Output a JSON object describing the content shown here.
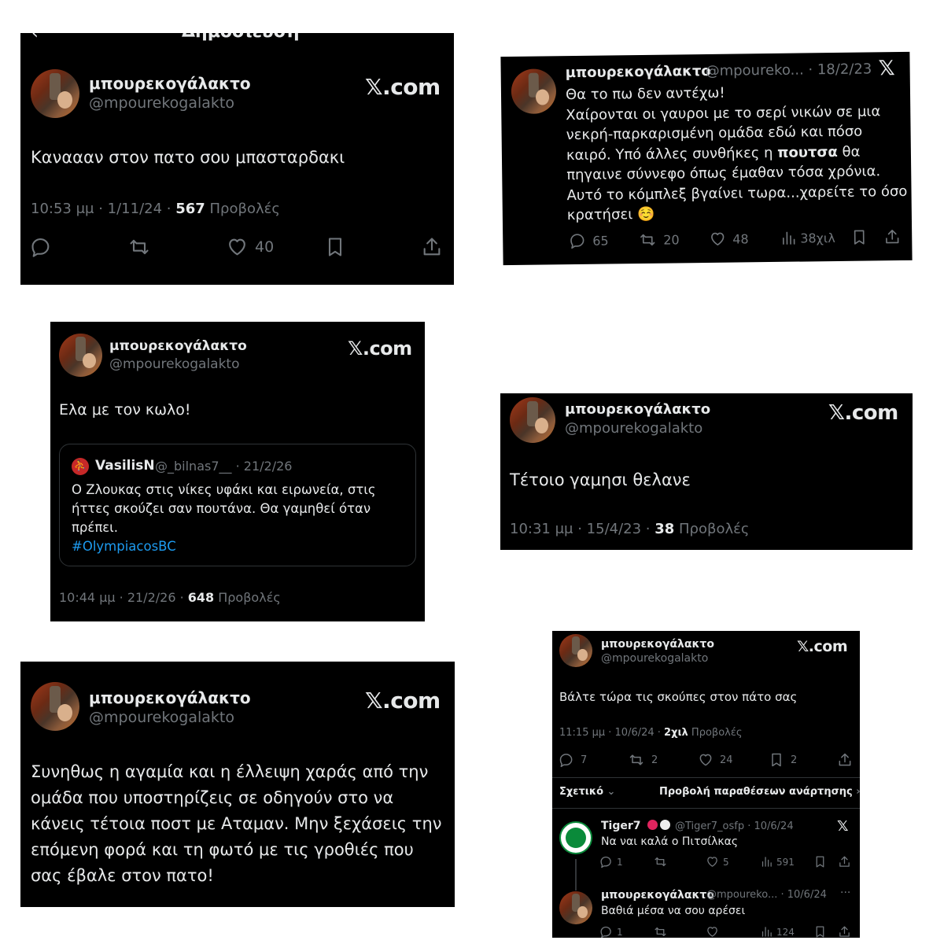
{
  "account": {
    "name": "μπουρεκογάλακτο",
    "handle": "@mpourekogalakto",
    "handle_short": "@mpoureko...",
    "brand": "𝕏.com",
    "x_logo": "𝕏"
  },
  "card1": {
    "header_partial": "Δημοσίευση",
    "text": "Καναααν στον πατο σου μπασταρδακι",
    "time": "10:53 μμ · 1/11/24 · ",
    "views": "567",
    "views_label": " Προβολές",
    "likes": "40"
  },
  "card2": {
    "date": " · 18/2/23",
    "line1": "Θα το πω δεν αντέχω!",
    "line2": "Χαίρονται οι γαυροι με το σερί νικών σε μια",
    "line3": "νεκρή-παρκαρισμένη ομάδα εδώ και πόσο",
    "line4a": "καιρό. Υπό άλλες συνθήκες η ",
    "line4b": "πουτσα",
    "line4c": " θα",
    "line5": "πηγαινε σύννεφο όπως έμαθαν τόσα χρόνια.",
    "line6": "Αυτό το κόμπλεξ βγαίνει τωρα...χαρείτε το όσο",
    "line7": "κρατήσει ☺️",
    "replies": "65",
    "reposts": "20",
    "likes": "48",
    "views": "38χιλ"
  },
  "card3": {
    "text": "Ελα με τον κωλο!",
    "quote_name": "VasilisN",
    "quote_handle": "@_bilnas7__",
    "quote_date": " · 21/2/26",
    "quote_line1": "Ο Ζλουκας στις νίκες υφάκι και ειρωνεία, στις",
    "quote_line2": "ήττες σκούζει σαν πουτάνα. Θα γαμηθεί όταν",
    "quote_line3": "πρέπει.",
    "quote_hashtag": "#OlympiacosBC",
    "time": "10:44 μμ · 21/2/26 · ",
    "views": "648",
    "views_label": " Προβολές"
  },
  "card4": {
    "text": "Τέτοιο γαμησι θελανε",
    "time": "10:31 μμ · 15/4/23 · ",
    "views": "38",
    "views_label": " Προβολές"
  },
  "card5": {
    "line1": "Συνηθως η αγαμία και η έλλειψη χαράς από την",
    "line2": "ομάδα που υποστηρίζεις σε οδηγούν στο να",
    "line3": "κάνεις τέτοια ποστ με Αταμαν. Μην ξεχάσεις την",
    "line4": "επόμενη φορά και τη φωτό με τις γροθιές που",
    "line5": "σας έβαλε στον πατο!"
  },
  "card6": {
    "text": "Βάλτε τώρα τις σκούπες στον πάτο σας",
    "time": "11:15 μμ · 10/6/24 · ",
    "views": "2χιλ",
    "views_label": " Προβολές",
    "replies": "7",
    "reposts": "2",
    "likes": "24",
    "bookmarks": "2",
    "relevant": "Σχετικό",
    "quotes_link": "Προβολή παραθέσεων ανάρτησης",
    "reply1_name": "Tiger7",
    "reply1_handle": "@Tiger7_osfp · 10/6/24",
    "reply1_text": "Να ναι καλά ο Πιτσίλκας",
    "reply1_replies": "1",
    "reply1_likes": "5",
    "reply1_views": "591",
    "reply2_date": " · 10/6/24",
    "reply2_text": "Βαθιά μέσα να σου αρέσει",
    "reply2_replies": "1",
    "reply2_views": "124",
    "more": "···"
  }
}
